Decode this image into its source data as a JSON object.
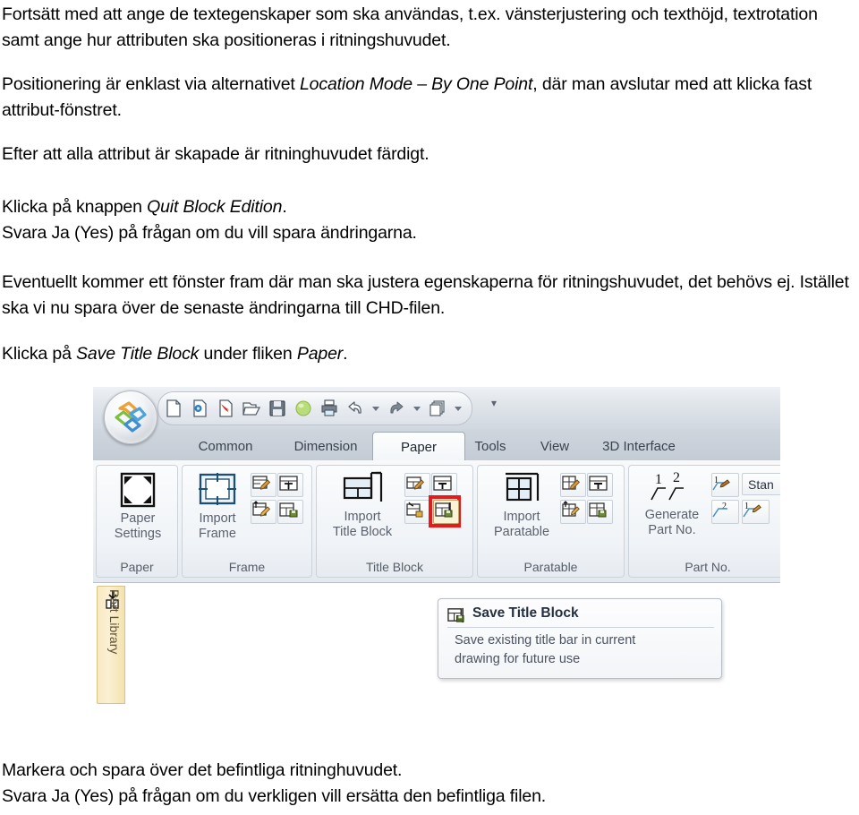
{
  "document": {
    "paragraphs": [
      {
        "id": "p1",
        "text": "Fortsätt med att ange de textegenskaper som ska användas, t.ex. vänsterjustering och texthöjd, textrotation samt ange hur attributen ska positioneras i ritningshuvudet."
      },
      {
        "id": "p2a",
        "text": "Positionering är enklast via alternativet "
      },
      {
        "id": "p2i",
        "text": "Location Mode – By One Point"
      },
      {
        "id": "p2b",
        "text": ", där man avslutar med att klicka fast attribut-fönstret."
      },
      {
        "id": "p3",
        "text": "Efter att alla attribut är skapade är ritninghuvudet färdigt."
      },
      {
        "id": "p4a",
        "text": "Klicka på knappen "
      },
      {
        "id": "p4i",
        "text": "Quit Block Edition"
      },
      {
        "id": "p4b",
        "text": "."
      },
      {
        "id": "p5",
        "text": "Svara Ja (Yes) på frågan om du vill spara ändringarna."
      },
      {
        "id": "p6",
        "text": "Eventuellt kommer ett fönster fram där man ska justera egenskaperna för ritningshuvudet, det behövs ej. Istället ska vi nu spara över de senaste ändringarna till CHD-filen."
      },
      {
        "id": "p7a",
        "text": "Klicka på "
      },
      {
        "id": "p7i",
        "text": "Save Title Block"
      },
      {
        "id": "p7b",
        "text": " under fliken "
      },
      {
        "id": "p7i2",
        "text": "Paper"
      },
      {
        "id": "p7c",
        "text": "."
      },
      {
        "id": "p8",
        "text": "Markera och spara över det befintliga ritninghuvudet.\nSvara Ja (Yes) på frågan om du verkligen vill ersätta den befintliga filen."
      }
    ]
  },
  "screenshot": {
    "app_logo_name": "application-menu-orb",
    "quick_access_toolbar": {
      "items": [
        {
          "name": "new-file-icon",
          "label": "New"
        },
        {
          "name": "new-from-template-icon",
          "label": "New from template"
        },
        {
          "name": "import-file-icon",
          "label": "Import"
        },
        {
          "name": "open-folder-icon",
          "label": "Open"
        },
        {
          "name": "save-icon",
          "label": "Save"
        },
        {
          "name": "render-icon",
          "label": "Render"
        },
        {
          "name": "print-icon",
          "label": "Print"
        },
        {
          "name": "undo-icon",
          "label": "Undo"
        },
        {
          "name": "undo-dropdown-icon",
          "label": "Undo history"
        },
        {
          "name": "redo-icon",
          "label": "Redo"
        },
        {
          "name": "redo-dropdown-icon",
          "label": "Redo history"
        },
        {
          "name": "copy-icon",
          "label": "Copy"
        },
        {
          "name": "copy-dropdown-icon",
          "label": "Copy options"
        }
      ],
      "overflow_label": "▾"
    },
    "tabs": [
      {
        "label": "Common",
        "active": false
      },
      {
        "label": "Dimension",
        "active": false
      },
      {
        "label": "Paper",
        "active": true
      },
      {
        "label": "Tools",
        "active": false
      },
      {
        "label": "View",
        "active": false
      },
      {
        "label": "3D Interface",
        "active": false
      }
    ],
    "panels": [
      {
        "label": "Paper",
        "big_button": {
          "label": "Paper\nSettings",
          "icon": "paper-settings-icon"
        },
        "small_buttons": []
      },
      {
        "label": "Frame",
        "big_button": {
          "label": "Import\nFrame",
          "icon": "import-frame-icon"
        },
        "small_buttons": [
          {
            "name": "edit-frame-icon"
          },
          {
            "name": "frame-attributes-icon"
          },
          {
            "name": "insert-frame-icon"
          },
          {
            "name": "save-frame-icon"
          }
        ]
      },
      {
        "label": "Title Block",
        "big_button": {
          "label": "Import\nTitle Block",
          "icon": "import-title-block-icon"
        },
        "small_buttons": [
          {
            "name": "edit-title-block-icon"
          },
          {
            "name": "title-block-attributes-icon"
          },
          {
            "name": "insert-title-block-icon"
          },
          {
            "name": "save-title-block-icon",
            "highlighted": true
          }
        ]
      },
      {
        "label": "Paratable",
        "big_button": {
          "label": "Import\nParatable",
          "icon": "import-paratable-icon"
        },
        "small_buttons": [
          {
            "name": "edit-paratable-icon"
          },
          {
            "name": "paratable-attributes-icon"
          },
          {
            "name": "insert-paratable-icon"
          },
          {
            "name": "save-paratable-icon"
          }
        ]
      },
      {
        "label": "Part No.",
        "big_button": {
          "label": "Generate\nPart No.",
          "icon": "generate-part-no-icon"
        },
        "small_buttons": [
          {
            "name": "edit-part-no-icon"
          },
          {
            "name": "part-no-sequence-icon"
          },
          {
            "name": "part-no-edit-icon"
          }
        ],
        "extra_label": "Stan"
      }
    ],
    "side_tab": {
      "label": "Part Library",
      "icon": "part-library-icon"
    },
    "tooltip": {
      "title": "Save Title Block",
      "body": "Save existing title bar in current\ndrawing for future use",
      "icon": "save-title-block-icon"
    },
    "colors": {
      "highlight": "#e8191b",
      "active_tab_bg": "#fdfefe",
      "ribbon_bg": "#eef1f5",
      "side_tab_bg": "#f7e9bf"
    }
  }
}
